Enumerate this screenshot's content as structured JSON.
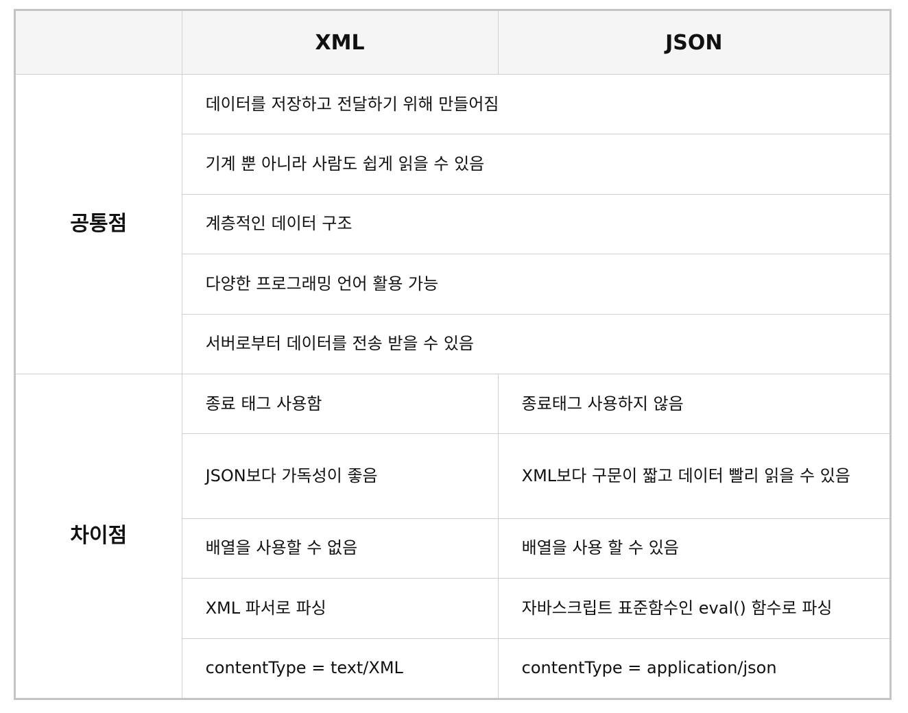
{
  "header": {
    "empty": "",
    "xml": "XML",
    "json": "JSON"
  },
  "common": {
    "label": "공통점",
    "rows": [
      "데이터를 저장하고 전달하기 위해 만들어짐",
      "기계 뿐 아니라 사람도 쉽게 읽을 수 있음",
      "계층적인 데이터 구조",
      "다양한 프로그래밍 언어 활용 가능",
      "서버로부터 데이터를 전송 받을 수 있음"
    ]
  },
  "differences": {
    "label": "차이점",
    "rows": [
      {
        "xml": "종료 태그 사용함",
        "json": "종료태그 사용하지 않음"
      },
      {
        "xml": "JSON보다 가독성이 좋음",
        "json": "XML보다 구문이 짧고 데이터 빨리 읽을 수 있음"
      },
      {
        "xml": "배열을 사용할 수 없음",
        "json": "배열을 사용 할 수 있음"
      },
      {
        "xml": "XML 파서로 파싱",
        "json": "자바스크립트 표준함수인 eval() 함수로 파싱"
      },
      {
        "xml": "contentType = text/XML",
        "json": "contentType = application/json"
      }
    ]
  }
}
